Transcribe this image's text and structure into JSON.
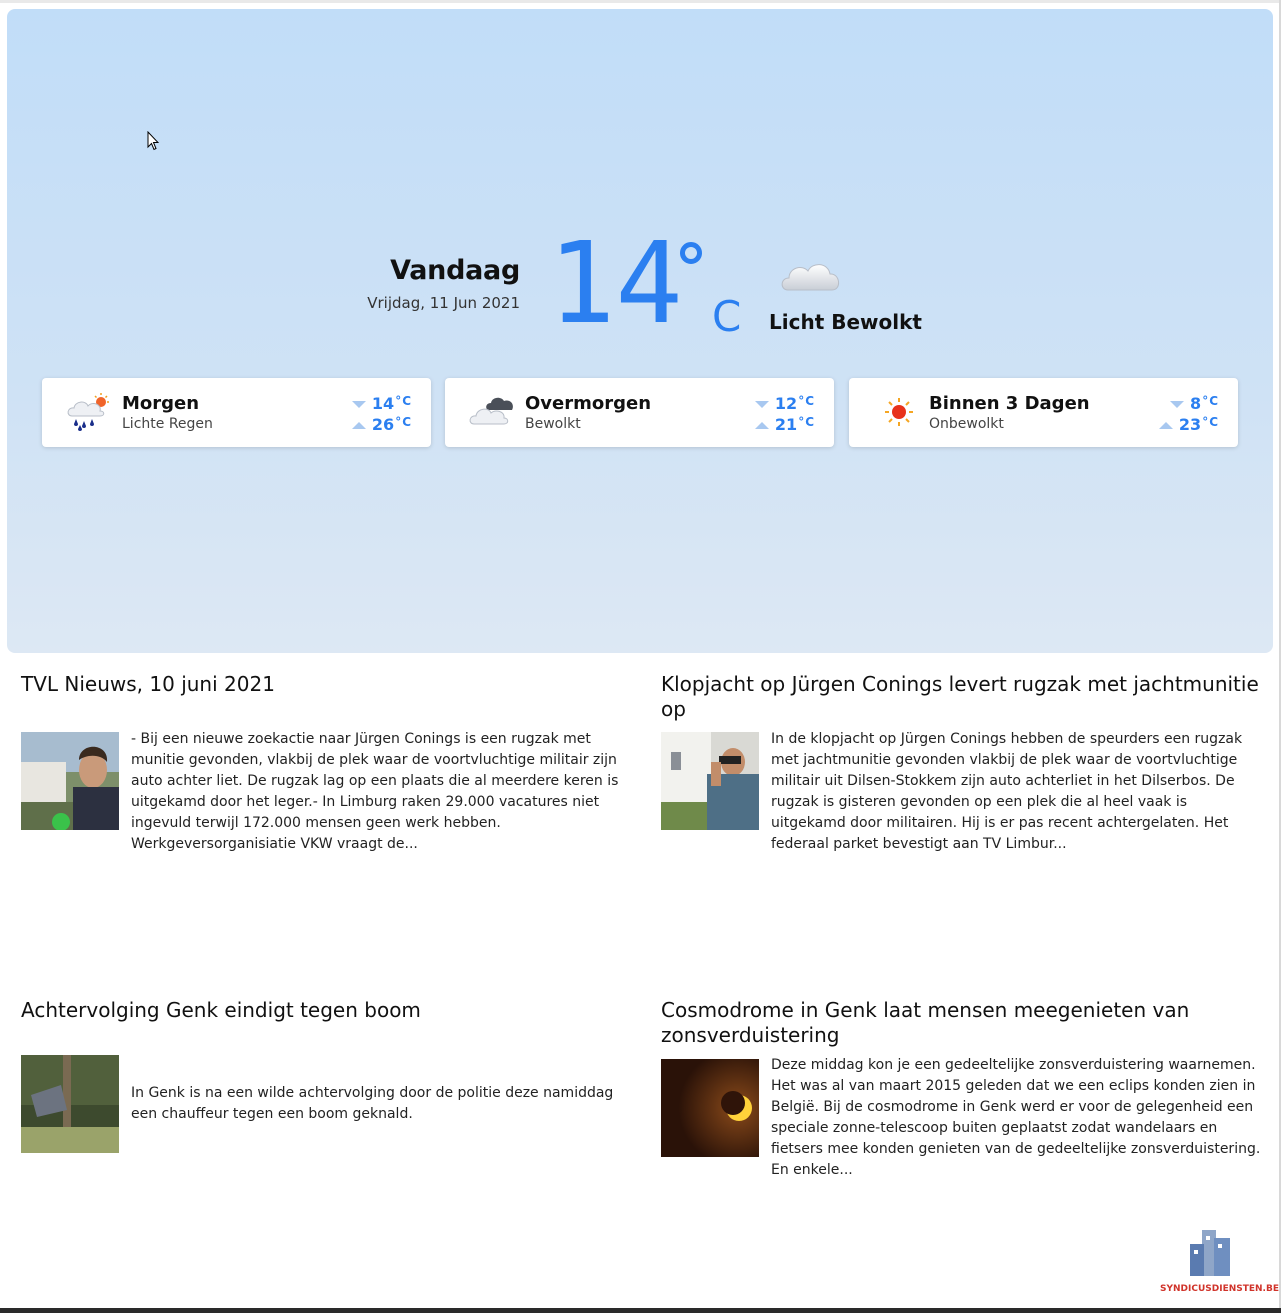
{
  "weather": {
    "today_label": "Vandaag",
    "today_date": "Vrijdag, 11 Jun 2021",
    "temperature": "14",
    "unit": "C",
    "condition": "Licht Bewolkt",
    "condition_icon": "cloud-icon",
    "forecast": [
      {
        "day": "Morgen",
        "condition": "Lichte Regen",
        "icon": "rain-sun-icon",
        "min": "14",
        "max": "26",
        "unit": "C"
      },
      {
        "day": "Overmorgen",
        "condition": "Bewolkt",
        "icon": "clouds-icon",
        "min": "12",
        "max": "21",
        "unit": "C"
      },
      {
        "day": "Binnen 3 Dagen",
        "condition": "Onbewolkt",
        "icon": "sun-icon",
        "min": "8",
        "max": "23",
        "unit": "C"
      }
    ],
    "accent_color": "#2b7ff0"
  },
  "news": [
    {
      "title": "TVL Nieuws, 10 juni 2021",
      "text": "- Bij een nieuwe zoekactie naar Jürgen Conings is een rugzak met munitie gevonden, vlakbij de plek waar de voortvluchtige militair zijn auto achter liet. De rugzak lag op een plaats die al meerdere keren is uitgekamd door het leger.- In Limburg raken 29.000 vacatures niet ingevuld terwijl 172.000 mensen geen werk hebben. Werkgeversorganisiatie VKW vraagt de..."
    },
    {
      "title": "Klopjacht op Jürgen Conings levert rugzak met jachtmunitie op",
      "text": "In de klopjacht op Jürgen Conings hebben de speurders een rugzak met jachtmunitie gevonden vlakbij de plek waar de voortvluchtige militair uit Dilsen-Stokkem zijn auto achterliet in het Dilserbos. De rugzak is gisteren gevonden op een plek die al heel vaak is uitgekamd door militairen. Hij is er pas recent achtergelaten. Het federaal parket bevestigt aan TV Limbur..."
    },
    {
      "title": "Achtervolging Genk eindigt tegen boom",
      "text": "In Genk is na een wilde achtervolging door de politie deze namiddag een chauffeur tegen een boom geknald."
    },
    {
      "title": "Cosmodrome in Genk laat mensen meegenieten van zonsverduistering",
      "text": "Deze middag kon je een gedeeltelijke zonsverduistering waarnemen. Het was al van maart 2015 geleden dat we een eclips konden zien in België. Bij de cosmodrome in Genk werd er voor de gelegenheid een speciale zonne-telescoop buiten geplaatst zodat wandelaars en fietsers mee konden genieten van de gedeeltelijke zonsverduistering. En enkele..."
    }
  ],
  "logo": {
    "text": "SYNDICUSDIENSTEN.BE",
    "icon": "building-logo-icon",
    "color": "#d0332a"
  }
}
